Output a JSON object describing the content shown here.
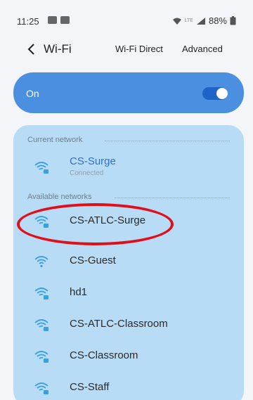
{
  "status_bar": {
    "time": "11:25",
    "battery": "88%",
    "network_label": "LTE"
  },
  "header": {
    "title": "Wi-Fi",
    "wifi_direct": "Wi-Fi Direct",
    "advanced": "Advanced"
  },
  "toggle_card": {
    "label": "On",
    "state": "on"
  },
  "sections": {
    "current": "Current network",
    "available": "Available networks"
  },
  "current_network": {
    "name": "CS-Surge",
    "status": "Connected"
  },
  "available_networks": [
    {
      "name": "CS-ATLC-Surge",
      "secured": true,
      "highlighted": true
    },
    {
      "name": "CS-Guest",
      "secured": false
    },
    {
      "name": "hd1",
      "secured": true
    },
    {
      "name": "CS-ATLC-Classroom",
      "secured": true
    },
    {
      "name": "CS-Classroom",
      "secured": true
    },
    {
      "name": "CS-Staff",
      "secured": true
    }
  ],
  "colors": {
    "accent": "#4b8fe0",
    "list_bg": "#b9dcf6",
    "highlight": "#e0101b",
    "wifi_icon": "#3aa0e0"
  }
}
